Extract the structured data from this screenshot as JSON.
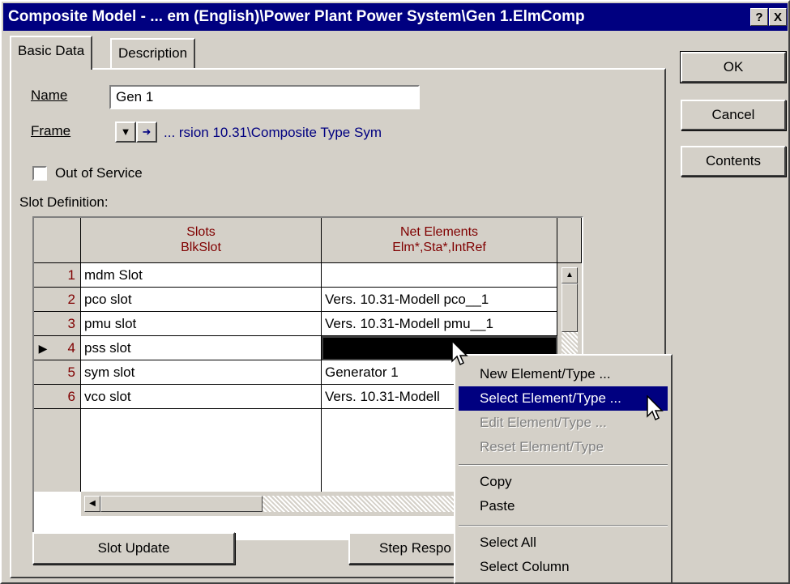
{
  "window": {
    "title": "Composite Model - ... em (English)\\Power Plant Power System\\Gen 1.ElmComp",
    "help_label": "?",
    "close_label": "X"
  },
  "tabs": [
    {
      "label": "Basic Data"
    },
    {
      "label": "Description"
    }
  ],
  "side_buttons": {
    "ok": "OK",
    "cancel": "Cancel",
    "contents": "Contents"
  },
  "form": {
    "name_label": "Name",
    "name_value": "Gen 1",
    "frame_label": "Frame",
    "frame_value": "... rsion 10.31\\Composite Type Sym",
    "out_of_service_label": "Out of Service",
    "slot_definition_label": "Slot Definition:"
  },
  "grid": {
    "col1_header_line1": "Slots",
    "col1_header_line2": "BlkSlot",
    "col2_header_line1": "Net Elements",
    "col2_header_line2": "Elm*,Sta*,IntRef",
    "rows": [
      {
        "num": "1",
        "slot": "mdm Slot",
        "element": ""
      },
      {
        "num": "2",
        "slot": "pco slot",
        "element": "Vers. 10.31-Modell pco__1"
      },
      {
        "num": "3",
        "slot": "pmu slot",
        "element": "Vers. 10.31-Modell pmu__1"
      },
      {
        "num": "4",
        "slot": "pss slot",
        "element": ""
      },
      {
        "num": "5",
        "slot": "sym slot",
        "element": "Generator 1"
      },
      {
        "num": "6",
        "slot": "vco slot",
        "element": "Vers. 10.31-Modell"
      }
    ]
  },
  "bottom_buttons": {
    "slot_update": "Slot Update",
    "step_response": "Step Respo"
  },
  "context_menu": {
    "items": [
      {
        "label": "New Element/Type ..."
      },
      {
        "label": "Select Element/Type ..."
      },
      {
        "label": "Edit Element/Type ..."
      },
      {
        "label": "Reset Element/Type"
      },
      {
        "label": "Copy"
      },
      {
        "label": "Paste"
      },
      {
        "label": "Select All"
      },
      {
        "label": "Select Column"
      }
    ]
  },
  "colors": {
    "title_bar": "#000080",
    "face": "#d4d0c8",
    "highlight": "#000080",
    "header_text": "#800000",
    "frame_link": "#000080"
  }
}
